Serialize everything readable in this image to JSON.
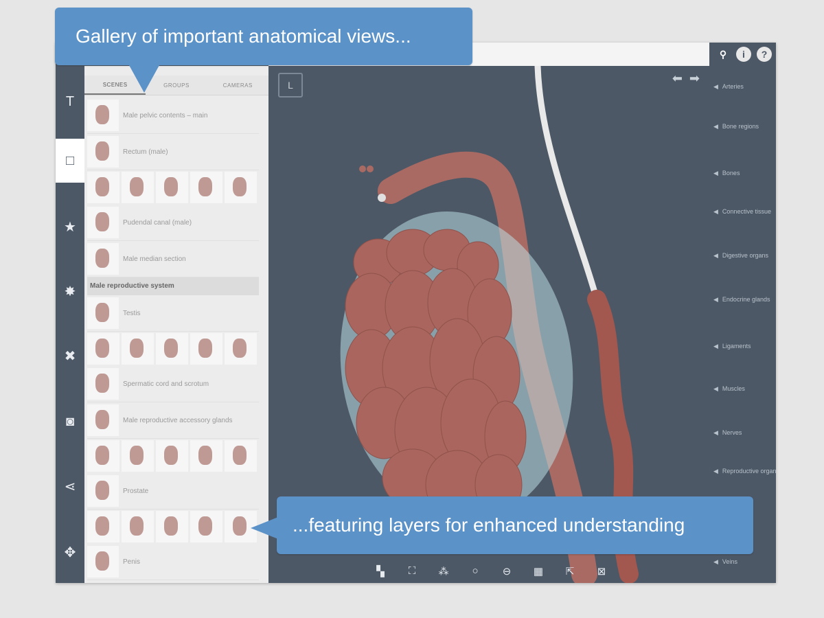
{
  "callouts": {
    "top": "Gallery of important anatomical views...",
    "bottom": "...featuring layers for enhanced understanding"
  },
  "tabs": [
    {
      "label": "SCENES",
      "active": true
    },
    {
      "label": "GROUPS",
      "active": false
    },
    {
      "label": "CAMERAS",
      "active": false
    }
  ],
  "left_toolbar": [
    {
      "icon": "text-icon",
      "glyph": "T"
    },
    {
      "icon": "square-icon",
      "glyph": "□"
    },
    {
      "icon": "star-icon",
      "glyph": "★"
    },
    {
      "icon": "gear-icon",
      "glyph": "✸"
    },
    {
      "icon": "tools-icon",
      "glyph": "✖"
    },
    {
      "icon": "camera-icon",
      "glyph": "◙"
    },
    {
      "icon": "share-icon",
      "glyph": "⋖"
    },
    {
      "icon": "move-icon",
      "glyph": "✥"
    }
  ],
  "scene_list": {
    "rows": [
      {
        "label": "Male pelvic contents – main"
      },
      {
        "label": "Rectum (male)"
      },
      {
        "label": "Pudendal canal (male)"
      },
      {
        "label": "Male median section"
      }
    ],
    "section_title": "Male reproductive system",
    "rows2": [
      {
        "label": "Testis"
      },
      {
        "label": "Spermatic cord and scrotum"
      },
      {
        "label": "Male reproductive accessory glands"
      },
      {
        "label": "Prostate"
      },
      {
        "label": "Penis"
      }
    ]
  },
  "viewport": {
    "view_label": "L",
    "tools": [
      {
        "name": "isolate-icon",
        "glyph": "▚"
      },
      {
        "name": "fit-icon",
        "glyph": "⛶"
      },
      {
        "name": "explode-icon",
        "glyph": "⁂"
      },
      {
        "name": "ghost-icon",
        "glyph": "○"
      },
      {
        "name": "hide-icon",
        "glyph": "⊖"
      },
      {
        "name": "select-all-icon",
        "glyph": "▦"
      },
      {
        "name": "pick-icon",
        "glyph": "⇱"
      },
      {
        "name": "reset-icon",
        "glyph": "⊠"
      }
    ]
  },
  "right_menu": [
    "Arteries",
    "Bone regions",
    "Bones",
    "Connective tissue",
    "Digestive organs",
    "Endocrine glands",
    "Ligaments",
    "Muscles",
    "Nerves",
    "Reproductive organs",
    "Veins"
  ],
  "colors": {
    "app_bg": "#4d5866",
    "callout": "#5b92c8",
    "tissue": "#b36e66"
  }
}
